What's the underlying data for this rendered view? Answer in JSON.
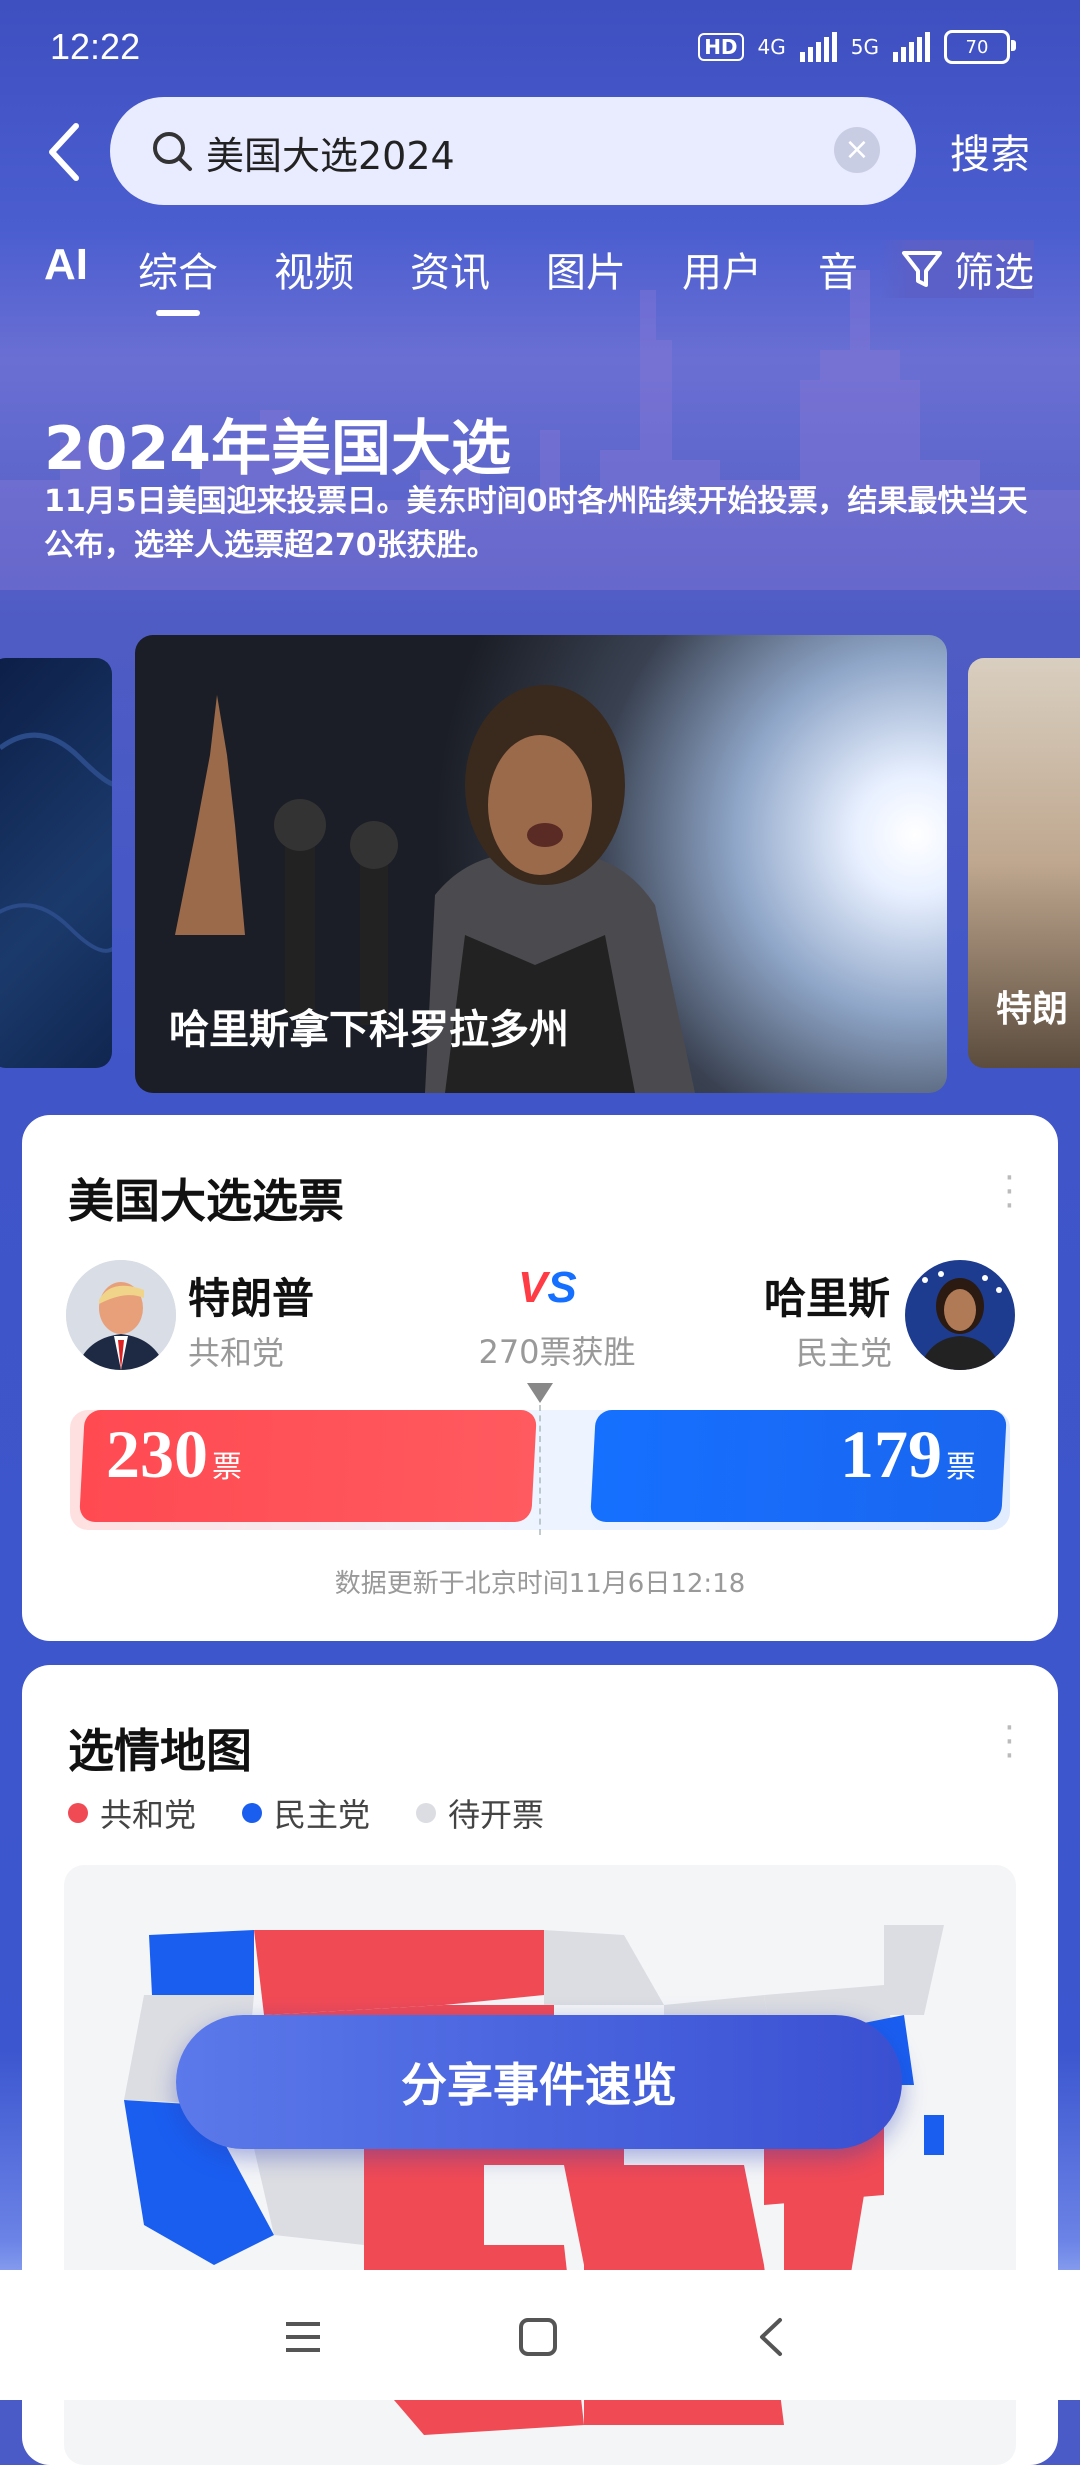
{
  "status": {
    "time": "12:22",
    "hd": "HD",
    "net1": "4G",
    "net2": "5G",
    "battery": "70"
  },
  "search": {
    "query": "美国大选2024",
    "button": "搜索"
  },
  "tabs": [
    "AI",
    "综合",
    "视频",
    "资讯",
    "图片",
    "用户",
    "音"
  ],
  "filter_label": "筛选",
  "hero": {
    "title": "2024年美国大选",
    "description": "11月5日美国迎来投票日。美东时间0时各州陆续开始投票，结果最快当天公布，选举人选票超270张获胜。"
  },
  "carousel": {
    "main_caption": "哈里斯拿下科罗拉多州",
    "right_caption": "特朗"
  },
  "vote": {
    "title": "美国大选选票",
    "left": {
      "name": "特朗普",
      "party": "共和党",
      "votes": "230",
      "unit": "票"
    },
    "right": {
      "name": "哈里斯",
      "party": "民主党",
      "votes": "179",
      "unit": "票"
    },
    "vs": "VS",
    "threshold": "270票获胜",
    "updated": "数据更新于北京时间11月6日12:18",
    "left_fraction": 0.426,
    "right_fraction": 0.331
  },
  "map": {
    "title": "选情地图",
    "legend": [
      {
        "label": "共和党",
        "color": "#f04a55"
      },
      {
        "label": "民主党",
        "color": "#1a5ef0"
      },
      {
        "label": "待开票",
        "color": "#dcdde2"
      }
    ]
  },
  "share_button": "分享事件速览",
  "colors": {
    "republican": "#ff4a52",
    "democrat": "#1670ff",
    "accent": "#4a5bd0"
  },
  "nav": {
    "icons": [
      "menu-icon",
      "home-icon",
      "back-icon"
    ]
  }
}
